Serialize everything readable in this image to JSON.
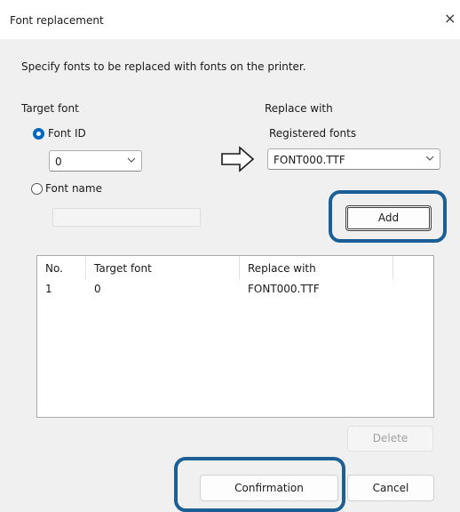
{
  "window": {
    "title": "Font replacement",
    "close_glyph": "×"
  },
  "instructions": "Specify fonts to be replaced with fonts on the printer.",
  "target": {
    "label": "Target font",
    "font_id": {
      "label": "Font ID",
      "selected": true,
      "value": "0"
    },
    "font_name": {
      "label": "Font name",
      "selected": false,
      "value": ""
    }
  },
  "replace": {
    "label": "Replace with",
    "registered_label": "Registered fonts",
    "value": "FONT000.TTF"
  },
  "buttons": {
    "add": "Add",
    "delete": "Delete",
    "confirmation": "Confirmation",
    "cancel": "Cancel"
  },
  "table": {
    "columns": [
      "No.",
      "Target font",
      "Replace with"
    ],
    "rows": [
      {
        "no": "1",
        "target": "0",
        "replace": "FONT000.TTF"
      }
    ]
  },
  "icons": {
    "arrow": "right-arrow-icon",
    "chevron": "chevron-down-icon",
    "close": "close-icon"
  },
  "colors": {
    "highlight": "#1c5f96",
    "radio_selected": "#0067c0",
    "background": "#f0f0f0"
  }
}
